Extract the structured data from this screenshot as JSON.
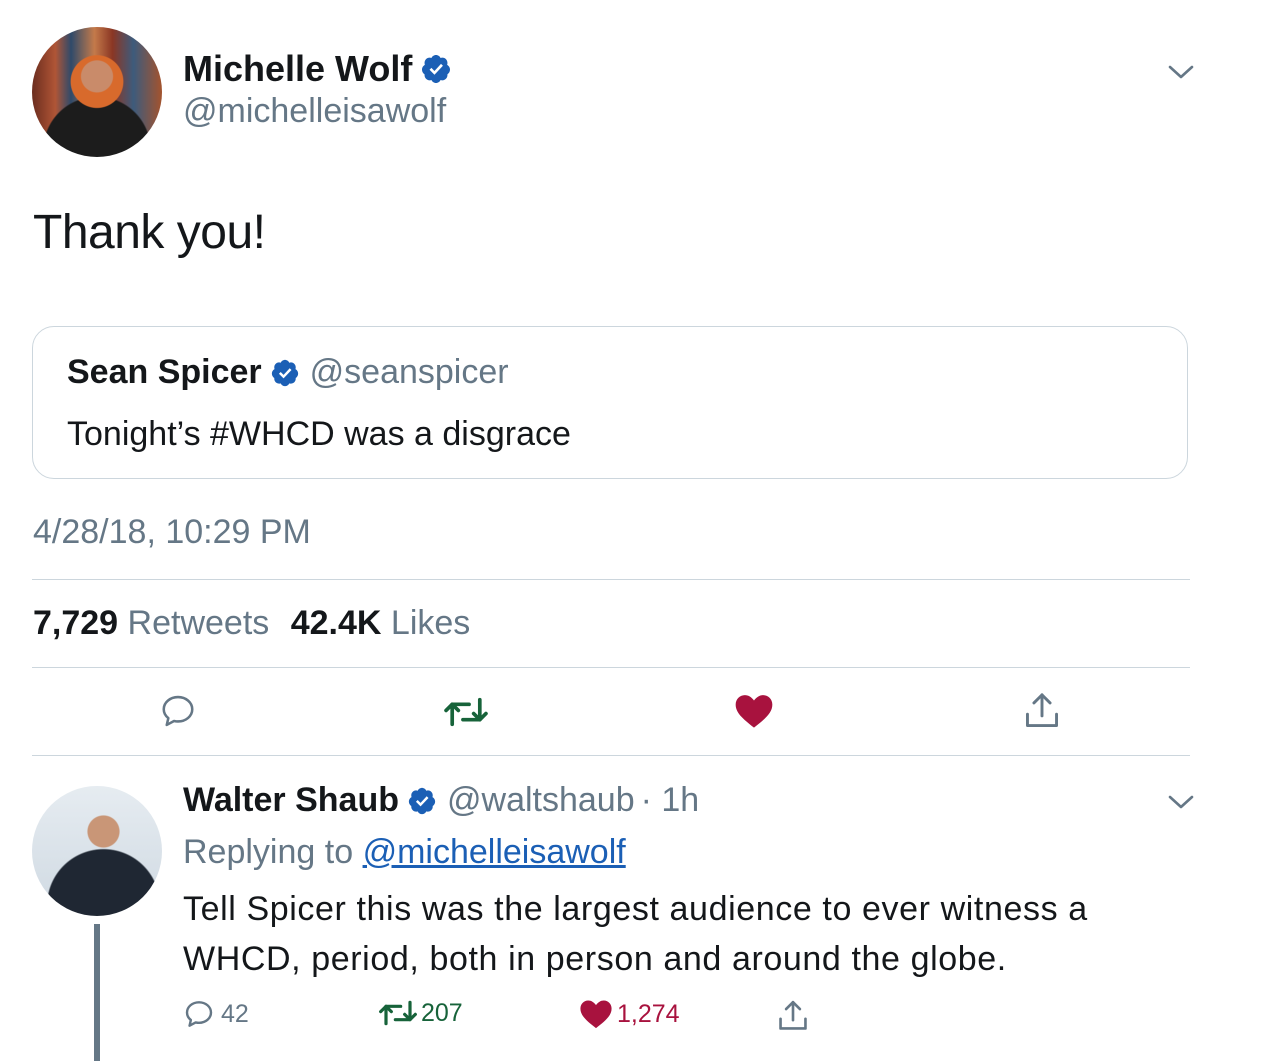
{
  "main_tweet": {
    "author_name": "Michelle Wolf",
    "author_handle": "@michelleisawolf",
    "text": "Thank you!",
    "timestamp": "4/28/18, 10:29 PM",
    "retweet_count": "7,729",
    "retweet_label": "Retweets",
    "like_count": "42.4K",
    "like_label": "Likes"
  },
  "quoted_tweet": {
    "author_name": "Sean Spicer",
    "author_handle": "@seanspicer",
    "text": "Tonight’s #WHCD was a disgrace"
  },
  "reply_tweet": {
    "author_name": "Walter Shaub",
    "author_handle": "@waltshaub",
    "time_ago": "· 1h",
    "replying_label": "Replying to",
    "replying_handle": "@michelleisawolf",
    "text": "Tell Spicer this was the largest audience to ever witness a WHCD, period, both in person and around the globe.",
    "reply_count": "42",
    "retweet_count": "207",
    "like_count": "1,274"
  },
  "colors": {
    "text_primary": "#14171a",
    "text_secondary": "#657786",
    "verified_blue": "#1b5fb5",
    "retweet_green": "#17633a",
    "like_red": "#a8123e",
    "divider": "#ccd6dd"
  },
  "icons": [
    "verified-badge-icon",
    "chevron-down-icon",
    "reply-icon",
    "retweet-icon",
    "like-icon",
    "share-icon"
  ]
}
